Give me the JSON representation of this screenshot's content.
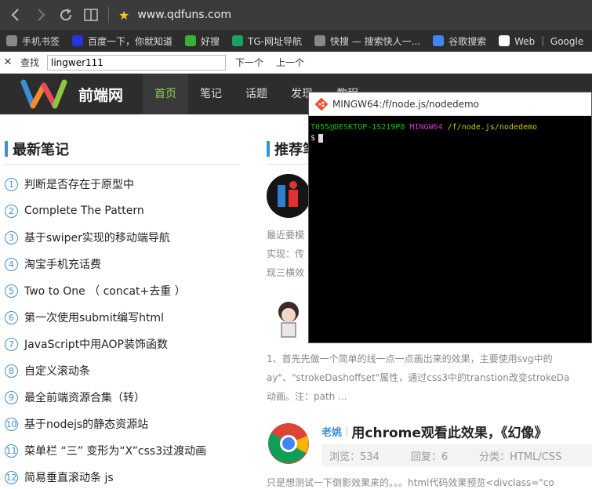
{
  "browser": {
    "url": "www.qdfuns.com",
    "bookmarks": [
      {
        "label": "手机书签",
        "icon": "folder-icon",
        "color": "#888888"
      },
      {
        "label": "百度一下，你就知道",
        "icon": "baidu-icon",
        "color": "#2932e1"
      },
      {
        "label": "好搜",
        "icon": "haosou-icon",
        "color": "#3cb034"
      },
      {
        "label": "TG-网址导航",
        "icon": "tg-icon",
        "color": "#1aa260"
      },
      {
        "label": "快搜 — 搜索快人一...",
        "icon": "kuaisou-icon",
        "color": "#888888"
      },
      {
        "label": "谷歌搜索",
        "icon": "google-icon",
        "color": "#4285f4"
      },
      {
        "label": "Web ｜ Google",
        "icon": "web-icon",
        "color": "#ffffff"
      }
    ]
  },
  "findbar": {
    "label": "查找",
    "query": "lingwer111",
    "next": "下一个",
    "prev": "上一个"
  },
  "site": {
    "name": "前端网",
    "nav": [
      "首页",
      "笔记",
      "话题",
      "发现",
      "教程"
    ]
  },
  "left": {
    "title": "最新笔记",
    "notes": [
      {
        "num": "1",
        "text": "判断是否存在于原型中"
      },
      {
        "num": "2",
        "text": "Complete The Pattern"
      },
      {
        "num": "3",
        "text": "基于swiper实现的移动端导航"
      },
      {
        "num": "4",
        "text": "淘宝手机充话费"
      },
      {
        "num": "5",
        "text": "Two to One （ concat+去重 ）"
      },
      {
        "num": "6",
        "text": "第一次使用submit编写html"
      },
      {
        "num": "7",
        "text": "JavaScript中用AOP装饰函数"
      },
      {
        "num": "8",
        "text": "自定义滚动条"
      },
      {
        "num": "9",
        "text": "最全前端资源合集（转）"
      },
      {
        "num": "10",
        "text": "基于nodejs的静态资源站"
      },
      {
        "num": "11",
        "text": "菜单栏 “三” 变形为“X”css3过渡动画"
      },
      {
        "num": "12",
        "text": "简易垂直滚动条 js"
      }
    ]
  },
  "right": {
    "title": "推荐笔记",
    "item1_lines": [
      "最近要模",
      "实现：传",
      "现三横效"
    ],
    "item2_lines": [
      "1、首先先做一个简单的线一点一点画出来的效果，主要使用svg中的",
      "ay\"、\"strokeDashoffset\"属性，通过css3中的transtion改变strokeDa",
      "动画。注：path ..."
    ],
    "item3": {
      "author": "老姚",
      "title": "用chrome观看此效果，《幻像》",
      "views": "浏览：534",
      "replies": "回复：6",
      "category": "分类：HTML/CSS",
      "excerpt": "只是想测试一下倒影效果来的。。。html代码效果预览<divclass=\"co"
    }
  },
  "terminal": {
    "title": "MINGW64:/f/node.js/nodedemo",
    "user": "T055@DESKTOP-1S219P8",
    "env": "MINGW64",
    "path": "/f/node.js/nodedemo",
    "prompt": "$"
  }
}
